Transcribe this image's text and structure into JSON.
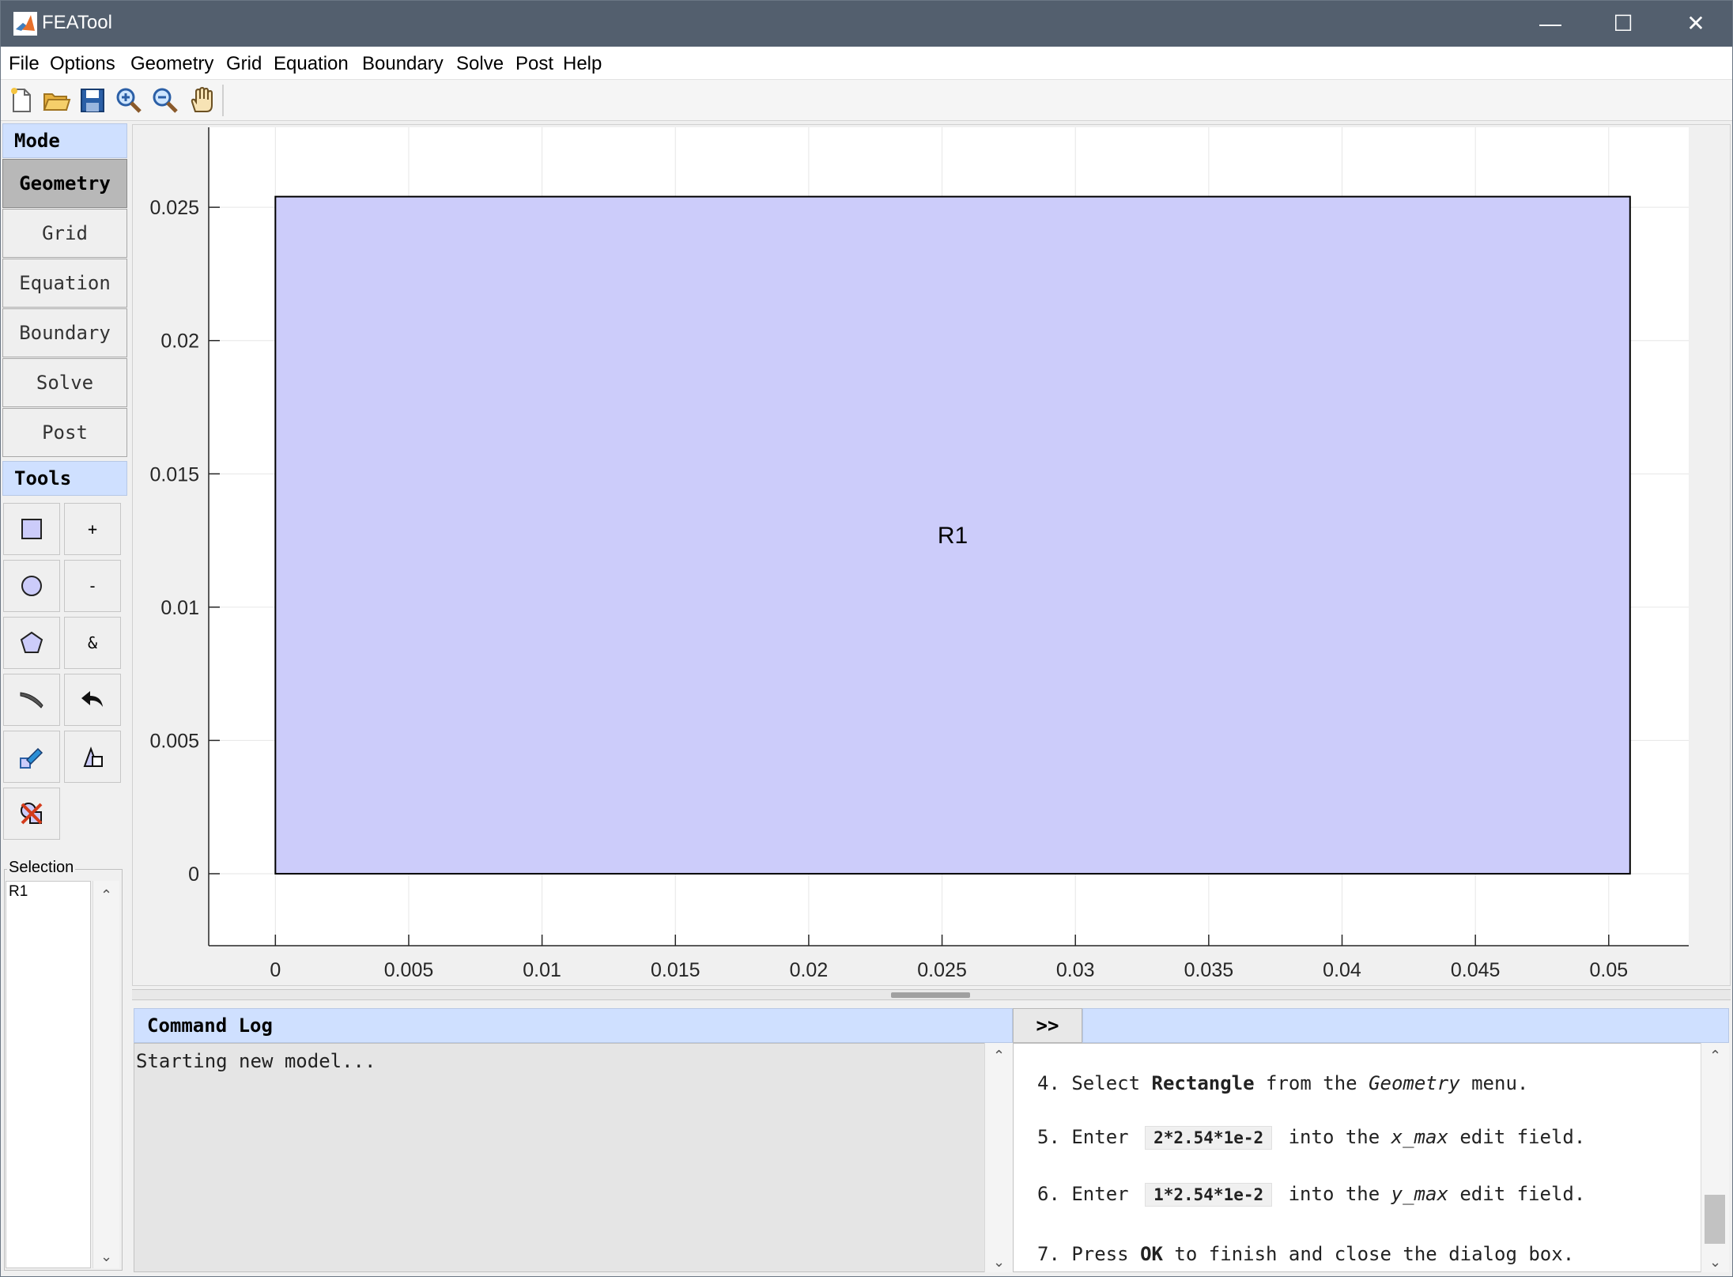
{
  "window": {
    "title": "FEATool",
    "minimize": "—",
    "maximize": "☐",
    "close": "✕"
  },
  "menu": [
    "File",
    "Options",
    "Geometry",
    "Grid",
    "Equation",
    "Boundary",
    "Solve",
    "Post",
    "Help"
  ],
  "toolbar": {
    "icons": [
      "new-file-icon",
      "open-folder-icon",
      "save-icon",
      "zoom-in-icon",
      "zoom-out-icon",
      "pan-hand-icon"
    ]
  },
  "left": {
    "mode_header": "Mode",
    "modes": [
      "Geometry",
      "Grid",
      "Equation",
      "Boundary",
      "Solve",
      "Post"
    ],
    "active_mode": "Geometry",
    "tools_header": "Tools",
    "tool_text": {
      "union": "+",
      "subtract": "-",
      "intersect": "&"
    },
    "tool_icons": [
      "rectangle-icon",
      "circle-icon",
      "polygon-icon",
      "line-icon",
      "undo-icon",
      "edit-object-icon",
      "transform-object-icon",
      "delete-object-icon"
    ],
    "selection_label": "Selection",
    "selection_items": [
      "R1"
    ]
  },
  "plot": {
    "object_label": "R1",
    "x_ticks": [
      "0",
      "0.005",
      "0.01",
      "0.015",
      "0.02",
      "0.025",
      "0.03",
      "0.035",
      "0.04",
      "0.045",
      "0.05"
    ],
    "y_ticks": [
      "0",
      "0.005",
      "0.01",
      "0.015",
      "0.02",
      "0.025"
    ],
    "x_range": [
      -0.0025,
      0.053
    ],
    "y_range": [
      -0.0027,
      0.028
    ],
    "rectangle": {
      "xmin": 0,
      "xmax": 0.0508,
      "ymin": 0,
      "ymax": 0.0254
    },
    "fill_color": "#ccccfa",
    "edge_color": "#000000",
    "grid": true
  },
  "command_log": {
    "header": "Command Log",
    "expand_label": ">>",
    "text": "Starting new model..."
  },
  "tutorial": {
    "step4": {
      "num": "4.",
      "a": "Select",
      "b": "Rectangle",
      "c": "from the",
      "d": "Geometry",
      "e": "menu."
    },
    "step5": {
      "num": "5.",
      "a": "Enter",
      "code": "2*2.54*1e-2",
      "b": "into the",
      "field": "x_max",
      "c": "edit field."
    },
    "step6": {
      "num": "6.",
      "a": "Enter",
      "code": "1*2.54*1e-2",
      "b": "into the",
      "field": "y_max",
      "c": "edit field."
    },
    "step7": {
      "num": "7.",
      "a": "Press",
      "b": "OK",
      "c": "to finish and close the dialog box."
    }
  }
}
